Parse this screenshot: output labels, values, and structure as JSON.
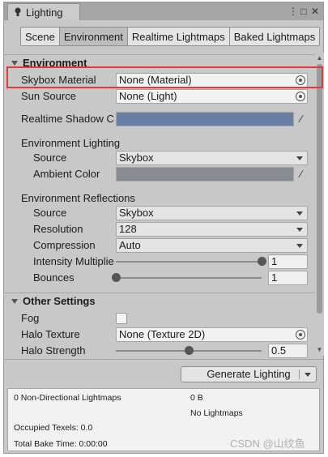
{
  "window": {
    "tab_title": "Lighting",
    "controls": {
      "menu": "⋮",
      "maximize": "□",
      "close": "✕"
    }
  },
  "mode_tabs": [
    {
      "label": "Scene",
      "active": false
    },
    {
      "label": "Environment",
      "active": true
    },
    {
      "label": "Realtime Lightmaps",
      "active": false
    },
    {
      "label": "Baked Lightmaps",
      "active": false
    }
  ],
  "environment": {
    "header": "Environment",
    "skybox_material": {
      "label": "Skybox Material",
      "value": "None (Material)"
    },
    "sun_source": {
      "label": "Sun Source",
      "value": "None (Light)"
    },
    "realtime_shadow_color": {
      "label": "Realtime Shadow Co",
      "color": "#6a7ea8"
    },
    "lighting": {
      "header": "Environment Lighting",
      "source": {
        "label": "Source",
        "value": "Skybox"
      },
      "ambient_color": {
        "label": "Ambient Color",
        "color": "#868b94"
      }
    },
    "reflections": {
      "header": "Environment Reflections",
      "source": {
        "label": "Source",
        "value": "Skybox"
      },
      "resolution": {
        "label": "Resolution",
        "value": "128"
      },
      "compression": {
        "label": "Compression",
        "value": "Auto"
      },
      "intensity_multiplier": {
        "label": "Intensity Multiplie",
        "value": "1",
        "fraction": 1.0
      },
      "bounces": {
        "label": "Bounces",
        "value": "1",
        "fraction": 0.0
      }
    }
  },
  "other_settings": {
    "header": "Other Settings",
    "fog": {
      "label": "Fog",
      "checked": false
    },
    "halo_texture": {
      "label": "Halo Texture",
      "value": "None (Texture 2D)"
    },
    "halo_strength": {
      "label": "Halo Strength",
      "value": "0.5",
      "fraction": 0.5
    }
  },
  "generate_button": {
    "label": "Generate Lighting"
  },
  "stats": {
    "non_directional": "0 Non-Directional Lightmaps",
    "size": "0 B",
    "no_lightmaps": "No Lightmaps",
    "occupied_texels": "Occupied Texels: 0.0",
    "total_bake_time": "Total Bake Time: 0:00:00"
  },
  "watermark": "CSDN @山纹鱼",
  "colors": {
    "highlight": "#e53935",
    "shadow_color": "#6a7ea8",
    "ambient_color": "#868b94"
  }
}
